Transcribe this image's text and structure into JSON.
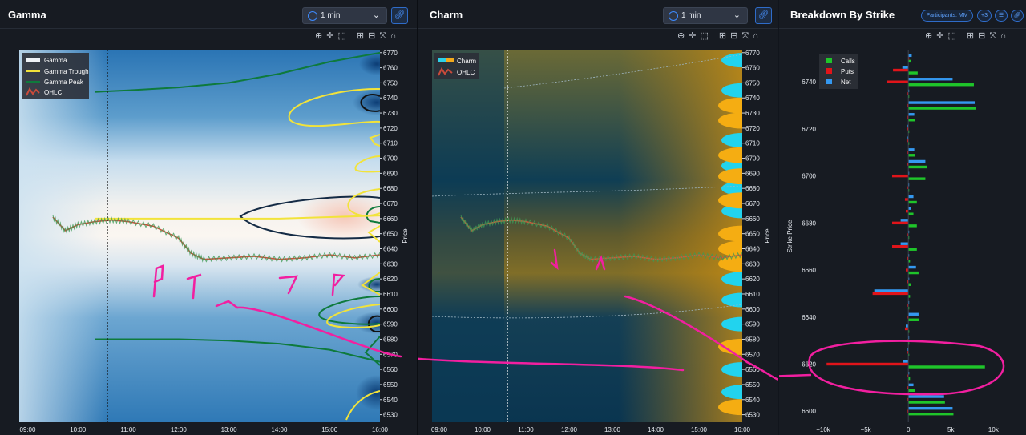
{
  "panels": {
    "gamma": {
      "title": "Gamma",
      "timeframe": "1 min",
      "legend": [
        "Gamma",
        "Gamma Trough",
        "Gamma Peak",
        "OHLC"
      ]
    },
    "charm": {
      "title": "Charm",
      "timeframe": "1 min",
      "legend": [
        "Charm",
        "OHLC"
      ]
    },
    "breakdown": {
      "title": "Breakdown By Strike",
      "participants_label": "Participants: MM",
      "plus_label": "+3"
    }
  },
  "colors": {
    "call": "#1fc52a",
    "put": "#e1141a",
    "net": "#3498f0",
    "annotation": "#f21fa0",
    "accent": "#3d8bff"
  },
  "icons": [
    "zoom-in-icon",
    "pan-icon",
    "select-box-icon",
    "zoom-add-icon",
    "zoom-out-icon",
    "autoscale-icon",
    "home-icon",
    "clock-icon",
    "link-icon",
    "settings-icon"
  ],
  "chart_data": [
    {
      "type": "heatmap",
      "title": "Gamma",
      "xlabel": "",
      "ylabel": "Price",
      "x_ticks": [
        "09:00",
        "10:00",
        "11:00",
        "12:00",
        "13:00",
        "14:00",
        "15:00",
        "16:00"
      ],
      "y_ticks": [
        6770,
        6760,
        6750,
        6740,
        6730,
        6720,
        6710,
        6700,
        6690,
        6680,
        6670,
        6660,
        6650,
        6640,
        6630,
        6620,
        6610,
        6600,
        6590,
        6580,
        6570,
        6560,
        6550,
        6540,
        6530
      ],
      "ylim": [
        6525,
        6772
      ],
      "xlim": [
        "08:50",
        "16:00"
      ],
      "legend_placement": "top-left",
      "series": [
        {
          "name": "Gamma Trough",
          "x": [
            "10:20",
            "11:00",
            "12:00",
            "13:00",
            "14:00",
            "15:00",
            "16:00"
          ],
          "values": [
            6660,
            6660,
            6660,
            6660,
            6660,
            6661,
            6662
          ]
        },
        {
          "name": "Gamma Peak",
          "x": [
            "10:20",
            "11:00",
            "12:00",
            "13:00",
            "14:00",
            "15:00",
            "16:00"
          ],
          "values": [
            6744,
            6745,
            6747,
            6750,
            6756,
            6764,
            6770
          ]
        },
        {
          "name": "Gamma Peak",
          "x": [
            "10:20",
            "11:00",
            "12:00",
            "13:00",
            "14:00",
            "15:00",
            "16:00"
          ],
          "values": [
            6580,
            6580,
            6580,
            6579,
            6577,
            6573,
            6565
          ]
        },
        {
          "name": "OHLC",
          "x": [
            "09:30",
            "09:45",
            "10:00",
            "10:20",
            "10:40",
            "11:00",
            "11:30",
            "12:00",
            "12:15",
            "12:30",
            "13:00",
            "13:30",
            "14:00",
            "14:30",
            "15:00",
            "15:30",
            "16:00"
          ],
          "values": [
            6661,
            6652,
            6656,
            6658,
            6659,
            6658,
            6655,
            6647,
            6637,
            6633,
            6634,
            6635,
            6633,
            6634,
            6636,
            6634,
            6636
          ]
        }
      ]
    },
    {
      "type": "heatmap",
      "title": "Charm",
      "xlabel": "",
      "ylabel": "Price",
      "x_ticks": [
        "09:00",
        "10:00",
        "11:00",
        "12:00",
        "13:00",
        "14:00",
        "15:00",
        "16:00"
      ],
      "y_ticks": [
        6770,
        6760,
        6750,
        6740,
        6730,
        6720,
        6710,
        6700,
        6690,
        6680,
        6670,
        6660,
        6650,
        6640,
        6630,
        6620,
        6610,
        6600,
        6590,
        6580,
        6570,
        6560,
        6550,
        6540,
        6530
      ],
      "ylim": [
        6525,
        6772
      ],
      "xlim": [
        "08:50",
        "16:00"
      ],
      "legend_placement": "top-left",
      "series": [
        {
          "name": "OHLC",
          "x": [
            "09:30",
            "09:45",
            "10:00",
            "10:20",
            "10:40",
            "11:00",
            "11:30",
            "12:00",
            "12:15",
            "12:30",
            "13:00",
            "13:30",
            "14:00",
            "14:30",
            "15:00",
            "15:30",
            "16:00"
          ],
          "values": [
            6661,
            6652,
            6656,
            6658,
            6659,
            6658,
            6655,
            6647,
            6637,
            6633,
            6634,
            6635,
            6633,
            6634,
            6636,
            6634,
            6636
          ]
        }
      ]
    },
    {
      "type": "bar",
      "orientation": "horizontal",
      "title": "Breakdown By Strike",
      "ylabel": "Strike Price",
      "xlabel": "",
      "x_ticks": [
        "−10k",
        "−5k",
        "0",
        "5k",
        "10k"
      ],
      "xlim": [
        -10000,
        11000
      ],
      "y_ticks": [
        6740,
        6720,
        6700,
        6680,
        6660,
        6640,
        6620,
        6600
      ],
      "ylim": [
        6597,
        6752
      ],
      "legend_placement": "top-left",
      "categories": [
        6750,
        6745,
        6740,
        6735,
        6730,
        6725,
        6720,
        6715,
        6710,
        6705,
        6700,
        6695,
        6690,
        6685,
        6680,
        6675,
        6670,
        6665,
        6660,
        6655,
        6650,
        6645,
        6640,
        6635,
        6630,
        6625,
        6620,
        6615,
        6610,
        6605,
        6600
      ],
      "series": [
        {
          "name": "Calls",
          "values": [
            300,
            1100,
            7700,
            100,
            7900,
            800,
            100,
            100,
            800,
            2200,
            2000,
            100,
            1000,
            600,
            1000,
            100,
            1000,
            200,
            1200,
            300,
            200,
            100,
            1300,
            100,
            100,
            100,
            9000,
            200,
            800,
            4300,
            5300
          ]
        },
        {
          "name": "Puts",
          "values": [
            100,
            -1800,
            -2500,
            -100,
            -100,
            -100,
            -200,
            -200,
            -100,
            -200,
            -1900,
            -100,
            -400,
            -300,
            -1900,
            -100,
            -1900,
            -200,
            -300,
            -200,
            -4200,
            -100,
            -100,
            -400,
            -100,
            -200,
            -9600,
            -100,
            -200,
            -100,
            -100
          ]
        },
        {
          "name": "Net",
          "values": [
            400,
            -700,
            5200,
            0,
            7800,
            700,
            -100,
            -100,
            700,
            2000,
            100,
            0,
            600,
            300,
            -900,
            0,
            -900,
            0,
            900,
            100,
            -4000,
            0,
            1200,
            -300,
            0,
            -100,
            -600,
            100,
            600,
            4200,
            5200
          ]
        }
      ]
    }
  ]
}
